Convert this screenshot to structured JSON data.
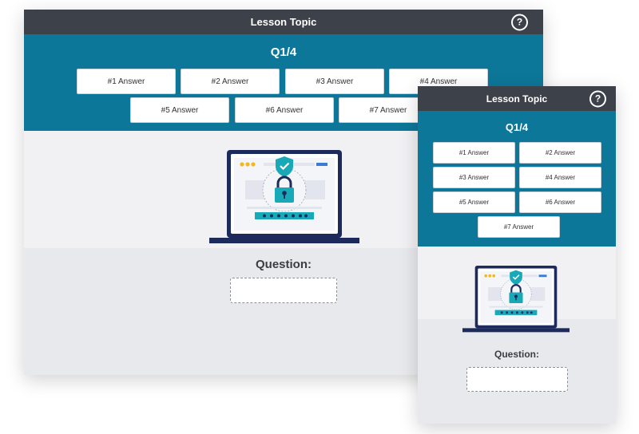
{
  "desktop": {
    "title": "Lesson Topic",
    "help_icon": "question-circle-icon",
    "question_counter": "Q1/4",
    "answers": [
      "#1 Answer",
      "#2 Answer",
      "#3 Answer",
      "#4 Answer",
      "#5 Answer",
      "#6 Answer",
      "#7 Answer"
    ],
    "question_label": "Question:",
    "answer_input_value": ""
  },
  "mobile": {
    "title": "Lesson Topic",
    "help_icon": "question-circle-icon",
    "question_counter": "Q1/4",
    "answers": [
      "#1 Answer",
      "#2 Answer",
      "#3 Answer",
      "#4 Answer",
      "#5 Answer",
      "#6 Answer",
      "#7 Answer"
    ],
    "question_label": "Question:",
    "answer_input_value": ""
  },
  "colors": {
    "header_bar": "#3d4149",
    "question_band": "#0d7799",
    "accent_teal": "#18a9b8",
    "laptop_navy": "#1d2a5c",
    "dots_yellow": "#f2b81f"
  },
  "illustration": "laptop-with-security-lock-icon"
}
